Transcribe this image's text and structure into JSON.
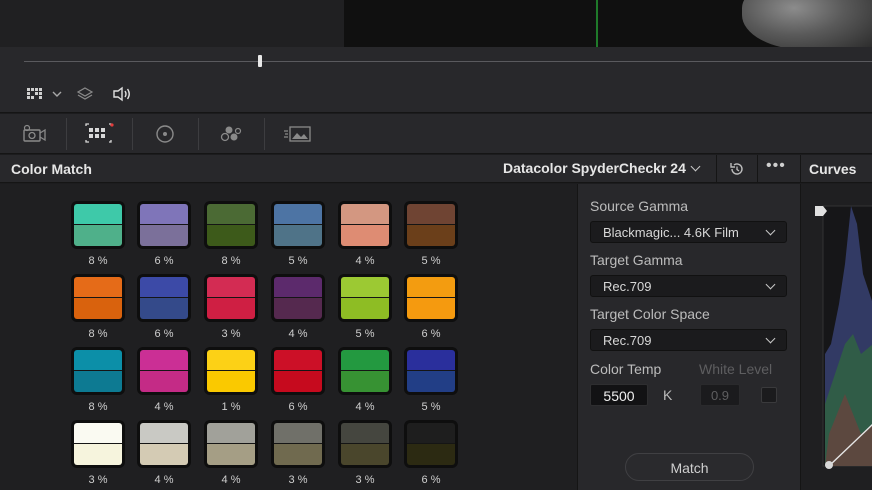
{
  "viewer": {
    "toolbar_icons": [
      "grid-view-icon",
      "chevron-down-icon",
      "layers-icon",
      "speaker-icon"
    ]
  },
  "toolbar": {
    "icons": [
      "camera-raw-icon",
      "color-match-icon",
      "color-wheels-icon",
      "rgb-mixer-icon",
      "motion-effects-icon"
    ]
  },
  "panel": {
    "title": "Color Match",
    "chart_select": "Datacolor SpyderCheckr 24",
    "curves_title": "Curves"
  },
  "swatches": [
    [
      {
        "top": "#3ec9a9",
        "bottom": "#4fb08a",
        "pct": "8 %"
      },
      {
        "top": "#7f75b9",
        "bottom": "#7b709a",
        "pct": "6 %"
      },
      {
        "top": "#4b6a34",
        "bottom": "#3d5a1a",
        "pct": "8 %"
      },
      {
        "top": "#4d74a4",
        "bottom": "#4f7388",
        "pct": "5 %"
      },
      {
        "top": "#d39781",
        "bottom": "#de8c73",
        "pct": "4 %"
      },
      {
        "top": "#6f4433",
        "bottom": "#6b3f1a",
        "pct": "5 %"
      }
    ],
    [
      {
        "top": "#e56b18",
        "bottom": "#d9620d",
        "pct": "8 %"
      },
      {
        "top": "#3c4aa7",
        "bottom": "#344a8a",
        "pct": "6 %"
      },
      {
        "top": "#d32c53",
        "bottom": "#cf1f43",
        "pct": "3 %"
      },
      {
        "top": "#5c2a6c",
        "bottom": "#55294f",
        "pct": "4 %"
      },
      {
        "top": "#9cc933",
        "bottom": "#8ebd24",
        "pct": "5 %"
      },
      {
        "top": "#f39c10",
        "bottom": "#f59a0f",
        "pct": "6 %"
      }
    ],
    [
      {
        "top": "#0c8fa8",
        "bottom": "#0d7a92",
        "pct": "8 %"
      },
      {
        "top": "#cb2f95",
        "bottom": "#c42b86",
        "pct": "4 %"
      },
      {
        "top": "#fcd116",
        "bottom": "#fac900",
        "pct": "1 %"
      },
      {
        "top": "#cc1027",
        "bottom": "#c60a1e",
        "pct": "6 %"
      },
      {
        "top": "#239940",
        "bottom": "#379233",
        "pct": "4 %"
      },
      {
        "top": "#2a2f9c",
        "bottom": "#223e86",
        "pct": "5 %"
      }
    ],
    [
      {
        "top": "#fafaf2",
        "bottom": "#f6f4dd",
        "pct": "3 %"
      },
      {
        "top": "#c9c9c4",
        "bottom": "#d4cbb4",
        "pct": "4 %"
      },
      {
        "top": "#a1a19a",
        "bottom": "#a59e85",
        "pct": "4 %"
      },
      {
        "top": "#707069",
        "bottom": "#706a4f",
        "pct": "3 %"
      },
      {
        "top": "#45463f",
        "bottom": "#4a462c",
        "pct": "3 %"
      },
      {
        "top": "#1e1e1e",
        "bottom": "#2c2a12",
        "pct": "6 %"
      }
    ]
  ],
  "settings": {
    "source_gamma_label": "Source Gamma",
    "source_gamma_value": "Blackmagic... 4.6K Film",
    "target_gamma_label": "Target Gamma",
    "target_gamma_value": "Rec.709",
    "target_color_space_label": "Target Color Space",
    "target_color_space_value": "Rec.709",
    "color_temp_label": "Color Temp",
    "color_temp_value": "5500",
    "color_temp_unit": "K",
    "white_level_label": "White Level",
    "white_level_value": "0.9",
    "match_button": "Match"
  },
  "colors": {
    "panel_bg": "#28282b",
    "grid_bg": "#1f1f21",
    "text": "#d6d6d6",
    "playhead_green": "#1f7a2a"
  }
}
